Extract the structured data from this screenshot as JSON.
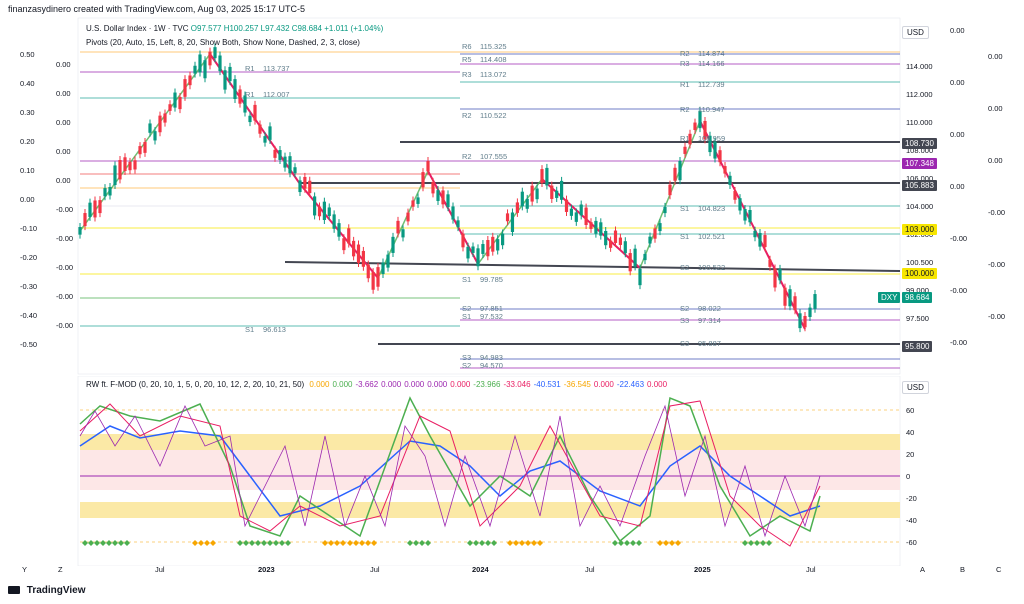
{
  "header": {
    "credit": "finanzasydinero created with TradingView.com, Aug 03, 2025 15:17 UTC-5"
  },
  "main_legend": {
    "symbol": "U.S. Dollar Index · 1W · TVC",
    "ohlc": "O97.577 H100.257 L97.432 C98.684 +1.011 (+1.04%)",
    "pivots": "Pivots (20, Auto, 15, Left, 8, 20, Show Both, Show None, Dashed, 2, 3, close)"
  },
  "left_axis_values": [
    "0.50",
    "0.40",
    "0.30",
    "0.20",
    "0.10",
    "0.00",
    "-0.10",
    "-0.20",
    "-0.30",
    "-0.40",
    "-0.50"
  ],
  "left_axis_values2": [
    "0.00",
    "0.00",
    "0.00",
    "0.00",
    "0.00",
    "-0.00",
    "-0.00",
    "-0.00",
    "-0.00",
    "-0.00"
  ],
  "price_axis": {
    "currency": "USD",
    "labels": [
      "114.000",
      "112.000",
      "110.000",
      "108.000",
      "106.000",
      "104.000",
      "102.000",
      "100.500",
      "99.000",
      "97.500",
      "94.700"
    ],
    "tags": [
      {
        "text": "108.730",
        "color": "#434651"
      },
      {
        "text": "107.348",
        "color": "#9c27b0"
      },
      {
        "text": "105.883",
        "color": "#434651"
      },
      {
        "text": "103.000",
        "color": "#f7e600"
      },
      {
        "text": "100.000",
        "color": "#f7e600"
      },
      {
        "text": "98.684",
        "color": "#089981"
      },
      {
        "text": "95.800",
        "color": "#434651"
      }
    ],
    "symbol_tag": "DXY"
  },
  "right_axis_values": [
    "0.00",
    "0.00",
    "0.00",
    "0.00",
    "0.00",
    "0.00",
    "0.00",
    "-0.00",
    "-0.00",
    "-0.00",
    "-0.00",
    "-0.00",
    "-0.00"
  ],
  "pivot_labels": [
    {
      "text": "R1",
      "val": "113.737"
    },
    {
      "text": "R1",
      "val": "112.007"
    },
    {
      "text": "R6",
      "val": "115.325"
    },
    {
      "text": "R5",
      "val": "114.408"
    },
    {
      "text": "R3",
      "val": "113.072"
    },
    {
      "text": "R2",
      "val": "110.522"
    },
    {
      "text": "R2",
      "val": "107.555"
    },
    {
      "text": "S1",
      "val": "99.785"
    },
    {
      "text": "S1",
      "val": "96.613"
    },
    {
      "text": "S2",
      "val": "97.851"
    },
    {
      "text": "S1",
      "val": "97.532"
    },
    {
      "text": "S3",
      "val": "94.983"
    },
    {
      "text": "S2",
      "val": "94.570"
    },
    {
      "text": "R2",
      "val": "114.874"
    },
    {
      "text": "R3",
      "val": "114.166"
    },
    {
      "text": "R1",
      "val": "112.739"
    },
    {
      "text": "R2",
      "val": "110.947"
    },
    {
      "text": "R1",
      "val": "108.959"
    },
    {
      "text": "S1",
      "val": "104.823"
    },
    {
      "text": "S1",
      "val": "102.521"
    },
    {
      "text": "S2",
      "val": "100.522"
    },
    {
      "text": "S2",
      "val": "98.022"
    },
    {
      "text": "S3",
      "val": "97.314"
    },
    {
      "text": "S3",
      "val": "95.887"
    }
  ],
  "oscillator": {
    "legend": "RW ft. F-MOD (0, 20, 10, 1, 5, 0, 20, 10, 12, 2, 20, 10, 21, 50)",
    "values": [
      {
        "v": "0.000",
        "c": "#f7a600"
      },
      {
        "v": "0.000",
        "c": "#4caf50"
      },
      {
        "v": "-3.662",
        "c": "#9c27b0"
      },
      {
        "v": "0.000",
        "c": "#9c27b0"
      },
      {
        "v": "0.000",
        "c": "#9c27b0"
      },
      {
        "v": "0.000",
        "c": "#9c27b0"
      },
      {
        "v": "0.000",
        "c": "#e91e63"
      },
      {
        "v": "-23.966",
        "c": "#4caf50"
      },
      {
        "v": "-33.046",
        "c": "#e91e63"
      },
      {
        "v": "-40.531",
        "c": "#2962ff"
      },
      {
        "v": "-36.545",
        "c": "#f7a600"
      },
      {
        "v": "0.000",
        "c": "#e91e63"
      },
      {
        "v": "-22.463",
        "c": "#2962ff"
      },
      {
        "v": "0.000",
        "c": "#e91e63"
      }
    ],
    "currency": "USD",
    "axis": [
      "60",
      "40",
      "20",
      "0",
      "-20",
      "-40",
      "-60"
    ]
  },
  "time_axis": [
    "Jul",
    "2023",
    "Jul",
    "2024",
    "Jul",
    "2025",
    "Jul"
  ],
  "bottom_controls": {
    "y": "Y",
    "z": "Z",
    "a": "A",
    "b": "B",
    "c": "C"
  },
  "footer": {
    "brand": "TradingView"
  },
  "colors": {
    "up": "#089981",
    "down": "#f23645",
    "accent": "#2962ff"
  }
}
